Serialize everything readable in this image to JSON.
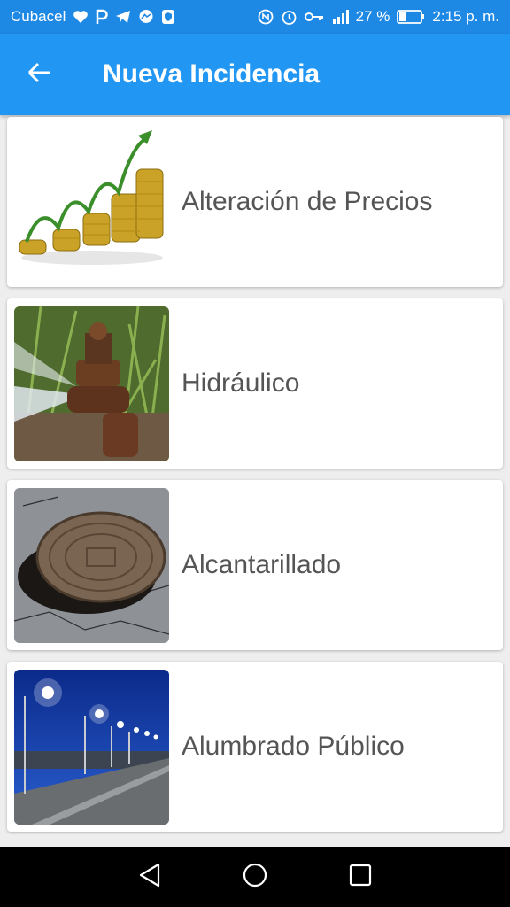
{
  "status_bar": {
    "carrier": "Cubacel",
    "battery": "27 %",
    "time": "2:15 p. m.",
    "icons": [
      "heart-icon",
      "p-icon",
      "telegram-icon",
      "messenger-icon",
      "shield-icon",
      "nfc-icon",
      "alarm-icon",
      "key-icon",
      "signal-icon",
      "battery-icon"
    ]
  },
  "app_bar": {
    "title": "Nueva Incidencia",
    "back_icon": "arrow-left-icon"
  },
  "categories": [
    {
      "label": "Alteración de Precios",
      "image": "coins-growth-image"
    },
    {
      "label": "Hidráulico",
      "image": "water-leak-image"
    },
    {
      "label": "Alcantarillado",
      "image": "manhole-cover-image"
    },
    {
      "label": "Alumbrado Público",
      "image": "street-lights-image"
    }
  ],
  "nav_bar": {
    "icons": [
      "back-triangle-icon",
      "home-circle-icon",
      "recents-square-icon"
    ]
  },
  "colors": {
    "status_bar": "#1e88e5",
    "app_bar": "#2196f3",
    "background": "#eeeeee",
    "card_text": "#555555"
  }
}
